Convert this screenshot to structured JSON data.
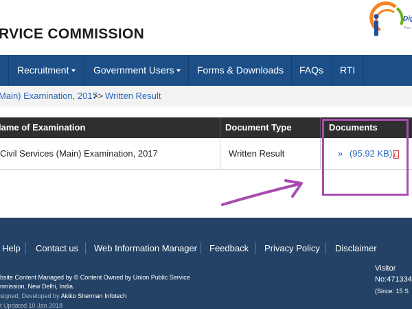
{
  "header": {
    "title": "RVICE COMMISSION",
    "logo_text": "Dig",
    "logo_sub": "Pow"
  },
  "nav": {
    "items": [
      {
        "label": "Recruitment",
        "has_dropdown": true
      },
      {
        "label": "Government Users",
        "has_dropdown": true
      },
      {
        "label": "Forms & Downloads",
        "has_dropdown": false
      },
      {
        "label": "FAQs",
        "has_dropdown": false
      },
      {
        "label": "RTI",
        "has_dropdown": false
      }
    ]
  },
  "breadcrumb": {
    "exam": "Main) Examination, 2017",
    "separator": ">>",
    "current": "Written Result"
  },
  "table": {
    "headers": [
      "Name of Examination",
      "Document Type",
      "Documents"
    ],
    "header_visible": [
      "lame of Examination",
      "Document Type",
      "Documents"
    ],
    "rows": [
      {
        "exam": "Civil Services (Main) Examination, 2017",
        "doc_type": "Written Result",
        "arrow": "»",
        "doc_size": "(95.92 KB)",
        "icon": "pdf-icon"
      }
    ]
  },
  "annotation": {
    "color": "#a94cb0"
  },
  "footer": {
    "links": [
      "Help",
      "Contact us",
      "Web Information Manager",
      "Feedback",
      "Privacy Policy",
      "Disclaimer"
    ],
    "line1": "bsite Content Managed by © Content Owned by Union Public Service",
    "line2": "nmission, New Delhi, India.",
    "line3_prefix": "signed, Developed by",
    "line3_company": "Akiko Sherman Infotech",
    "line4": "t Updated 10 Jan 2018",
    "visitor_label": "Visitor",
    "visitor_count": "No:471334",
    "since": "(Since: 15 S"
  },
  "colors": {
    "nav_bg": "#1c4f87",
    "footer_bg": "#234265",
    "table_header_bg": "#2f2f2f",
    "link": "#2a66b8"
  }
}
